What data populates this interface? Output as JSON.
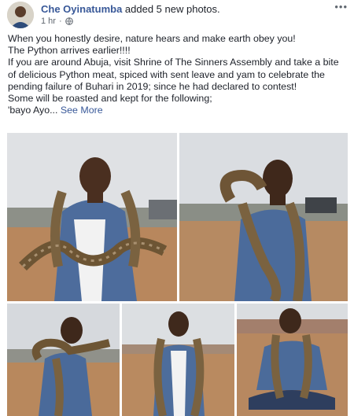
{
  "post": {
    "author": "Che Oyinatumba",
    "action": "added 5 new photos.",
    "time": "1 hr",
    "privacy_icon": "globe-icon",
    "more_icon": "ellipsis-icon",
    "text": {
      "line1": "When you honestly desire, nature hears and make earth obey you!",
      "line2": "The Python arrives earlier!!!!",
      "line3": "If you are around Abuja, visit Shrine of The Sinners Assembly and take a bite of delicious Python meat, spiced with sent leave and yam to celebrate the pending failure of Buhari in 2019; since he had declared to contest!",
      "line4": "Some will be roasted and kept for the following;",
      "line5": "'bayo Ayo...",
      "see_more": "See More"
    }
  },
  "colors": {
    "link": "#385898",
    "text": "#1d2129",
    "meta": "#606770",
    "sky": "#d9dce0",
    "ground": "#b78a63",
    "shirt": "#4a6a9a"
  },
  "photos": [
    {
      "name": "photo-1",
      "subject": "man holding python across shoulders"
    },
    {
      "name": "photo-2",
      "subject": "man kissing python head"
    },
    {
      "name": "photo-3",
      "subject": "man with python around neck"
    },
    {
      "name": "photo-4",
      "subject": "man with python, front view"
    },
    {
      "name": "photo-5",
      "subject": "man crouching with python"
    }
  ]
}
